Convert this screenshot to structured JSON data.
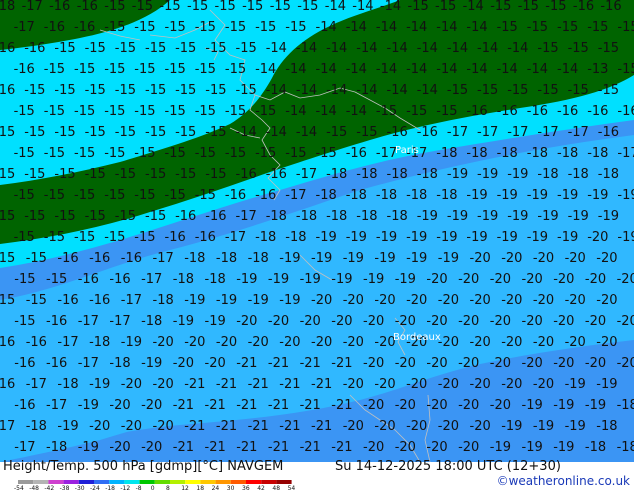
{
  "map": {
    "colors": {
      "band_m14_to_m18_green": "#006400",
      "band_m12_to_m15_cyan": "#00e0ff",
      "band_m18_to_m20_lightblue": "#30b8ff",
      "band_m20_to_m22_blue": "#3b95f4",
      "coast_lines": "#c0c0c0"
    },
    "cities": [
      {
        "name": "Paris"
      },
      {
        "name": "Bordeaux"
      }
    ],
    "contour_rows": [
      {
        "labels": [
          "-18",
          "-17",
          "-16",
          "-16",
          "-15",
          "-15",
          "-15",
          "-15",
          "-15",
          "-15",
          "-15",
          "-15",
          "-14",
          "-14",
          "-14",
          "-15",
          "-15",
          "-14",
          "-15",
          "-15",
          "-15",
          "-16",
          "-16"
        ]
      },
      {
        "labels": [
          "-17",
          "-16",
          "-16",
          "-15",
          "-15",
          "-15",
          "-15",
          "-15",
          "-15",
          "-15",
          "-14",
          "-14",
          "-14",
          "-14",
          "-14",
          "-14",
          "-15",
          "-15",
          "-15",
          "-15",
          "-15"
        ]
      },
      {
        "labels": [
          "-16",
          "-16",
          "-15",
          "-15",
          "-15",
          "-15",
          "-15",
          "-15",
          "-15",
          "-14",
          "-14",
          "-14",
          "-14",
          "-14",
          "-14",
          "-14",
          "-14",
          "-14",
          "-15",
          "-15",
          "-15"
        ]
      },
      {
        "labels": [
          "-16",
          "-15",
          "-15",
          "-15",
          "-15",
          "-15",
          "-15",
          "-15",
          "-14",
          "-14",
          "-14",
          "-14",
          "-14",
          "-14",
          "-14",
          "-14",
          "-14",
          "-14",
          "-14",
          "-13",
          "-15"
        ]
      },
      {
        "labels": [
          "-16",
          "-15",
          "-15",
          "-15",
          "-15",
          "-15",
          "-15",
          "-15",
          "-15",
          "-14",
          "-14",
          "-14",
          "-14",
          "-14",
          "-14",
          "-15",
          "-15",
          "-15",
          "-15",
          "-15",
          "-15"
        ]
      },
      {
        "labels": [
          "-15",
          "-15",
          "-15",
          "-15",
          "-15",
          "-15",
          "-15",
          "-15",
          "-15",
          "-14",
          "-14",
          "-14",
          "-15",
          "-15",
          "-15",
          "-16",
          "-16",
          "-16",
          "-16",
          "-16",
          "-16"
        ]
      },
      {
        "labels": [
          "-15",
          "-15",
          "-15",
          "-15",
          "-15",
          "-15",
          "-15",
          "-15",
          "-14",
          "-14",
          "-14",
          "-15",
          "-15",
          "-16",
          "-16",
          "-17",
          "-17",
          "-17",
          "-17",
          "-17",
          "-16"
        ]
      },
      {
        "labels": [
          "-15",
          "-15",
          "-15",
          "-15",
          "-15",
          "-15",
          "-15",
          "-15",
          "-15",
          "-15",
          "-15",
          "-16",
          "-17",
          "-17",
          "-18",
          "-18",
          "-18",
          "-18",
          "-18",
          "-18",
          "-17"
        ]
      },
      {
        "labels": [
          "-15",
          "-15",
          "-15",
          "-15",
          "-15",
          "-15",
          "-15",
          "-15",
          "-16",
          "-16",
          "-17",
          "-18",
          "-18",
          "-18",
          "-18",
          "-19",
          "-19",
          "-19",
          "-18",
          "-18",
          "-18"
        ]
      },
      {
        "labels": [
          "-15",
          "-15",
          "-15",
          "-15",
          "-15",
          "-15",
          "-15",
          "-16",
          "-16",
          "-17",
          "-18",
          "-18",
          "-18",
          "-18",
          "-18",
          "-19",
          "-19",
          "-19",
          "-19",
          "-19",
          "-19"
        ]
      },
      {
        "labels": [
          "-15",
          "-15",
          "-15",
          "-15",
          "-15",
          "-15",
          "-16",
          "-16",
          "-17",
          "-18",
          "-18",
          "-18",
          "-18",
          "-18",
          "-19",
          "-19",
          "-19",
          "-19",
          "-19",
          "-19",
          "-19"
        ]
      },
      {
        "labels": [
          "-15",
          "-15",
          "-15",
          "-15",
          "-15",
          "-16",
          "-16",
          "-17",
          "-18",
          "-18",
          "-19",
          "-19",
          "-19",
          "-19",
          "-19",
          "-19",
          "-19",
          "-19",
          "-19",
          "-20",
          "-19"
        ]
      },
      {
        "labels": [
          "-15",
          "-15",
          "-16",
          "-16",
          "-16",
          "-17",
          "-18",
          "-18",
          "-18",
          "-19",
          "-19",
          "-19",
          "-19",
          "-19",
          "-19",
          "-20",
          "-20",
          "-20",
          "-20",
          "-20"
        ]
      },
      {
        "labels": [
          "-15",
          "-15",
          "-16",
          "-16",
          "-17",
          "-18",
          "-18",
          "-19",
          "-19",
          "-19",
          "-19",
          "-19",
          "-19",
          "-20",
          "-20",
          "-20",
          "-20",
          "-20",
          "-20",
          "-20"
        ]
      },
      {
        "labels": [
          "-15",
          "-15",
          "-16",
          "-16",
          "-17",
          "-18",
          "-19",
          "-19",
          "-19",
          "-19",
          "-20",
          "-20",
          "-20",
          "-20",
          "-20",
          "-20",
          "-20",
          "-20",
          "-20",
          "-20"
        ]
      },
      {
        "labels": [
          "-15",
          "-16",
          "-17",
          "-17",
          "-18",
          "-19",
          "-19",
          "-20",
          "-20",
          "-20",
          "-20",
          "-20",
          "-20",
          "-20",
          "-20",
          "-20",
          "-20",
          "-20",
          "-20",
          "-20"
        ]
      },
      {
        "labels": [
          "-16",
          "-16",
          "-17",
          "-18",
          "-19",
          "-20",
          "-20",
          "-20",
          "-20",
          "-20",
          "-20",
          "-20",
          "-20",
          "-20",
          "-20",
          "-20",
          "-20",
          "-20",
          "-20",
          "-20"
        ]
      },
      {
        "labels": [
          "-16",
          "-16",
          "-17",
          "-18",
          "-19",
          "-20",
          "-20",
          "-21",
          "-21",
          "-21",
          "-21",
          "-20",
          "-20",
          "-20",
          "-20",
          "-20",
          "-20",
          "-20",
          "-20",
          "-20"
        ]
      },
      {
        "labels": [
          "-16",
          "-17",
          "-18",
          "-19",
          "-20",
          "-20",
          "-21",
          "-21",
          "-21",
          "-21",
          "-21",
          "-20",
          "-20",
          "-20",
          "-20",
          "-20",
          "-20",
          "-20",
          "-19",
          "-19"
        ]
      },
      {
        "labels": [
          "-16",
          "-17",
          "-19",
          "-20",
          "-20",
          "-21",
          "-21",
          "-21",
          "-21",
          "-21",
          "-21",
          "-20",
          "-20",
          "-20",
          "-20",
          "-20",
          "-19",
          "-19",
          "-19",
          "-18"
        ]
      },
      {
        "labels": [
          "-17",
          "-18",
          "-19",
          "-20",
          "-20",
          "-20",
          "-21",
          "-21",
          "-21",
          "-21",
          "-21",
          "-20",
          "-20",
          "-20",
          "-20",
          "-20",
          "-19",
          "-19",
          "-19",
          "-18"
        ]
      },
      {
        "labels": [
          "-17",
          "-18",
          "-19",
          "-20",
          "-20",
          "-21",
          "-21",
          "-21",
          "-21",
          "-21",
          "-21",
          "-20",
          "-20",
          "-20",
          "-20",
          "-19",
          "-19",
          "-19",
          "-18",
          "-18"
        ]
      }
    ]
  },
  "footer": {
    "title_left": "Height/Temp. 500 hPa [gdmp][°C] NAVGEM",
    "title_right": "Su 14-12-2025 18:00 UTC (12+30)",
    "credit": "©weatheronline.co.uk",
    "scale_labels": [
      "-54",
      "-48",
      "-42",
      "-38",
      "-30",
      "-24",
      "-18",
      "-12",
      "-8",
      "0",
      "8",
      "12",
      "18",
      "24",
      "30",
      "36",
      "42",
      "48",
      "54"
    ],
    "scale_colors": [
      "#9a9a9a",
      "#b4b4b4",
      "#cf40cf",
      "#9b20e0",
      "#2020d8",
      "#2f6df5",
      "#00b4ff",
      "#00e6ee",
      "#00c800",
      "#64dc00",
      "#b4f000",
      "#ffff00",
      "#ffc800",
      "#ff9600",
      "#ff5a00",
      "#ff0000",
      "#c80000",
      "#960000"
    ]
  }
}
